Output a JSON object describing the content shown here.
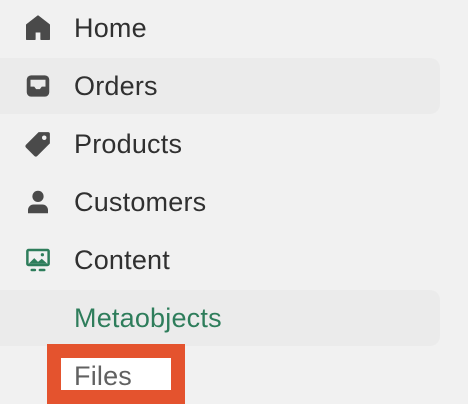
{
  "nav": {
    "items": [
      {
        "label": "Home",
        "icon": "home-icon"
      },
      {
        "label": "Orders",
        "icon": "inbox-icon"
      },
      {
        "label": "Products",
        "icon": "tag-icon"
      },
      {
        "label": "Customers",
        "icon": "person-icon"
      },
      {
        "label": "Content",
        "icon": "image-icon"
      }
    ],
    "subitems": [
      {
        "label": "Metaobjects",
        "state": "active"
      },
      {
        "label": "Files",
        "state": "highlighted"
      }
    ]
  },
  "colors": {
    "icon": "#4a4a4a",
    "content_icon": "#2e7d5b",
    "active_text": "#2e7d5b",
    "highlight": "#e4532e"
  }
}
